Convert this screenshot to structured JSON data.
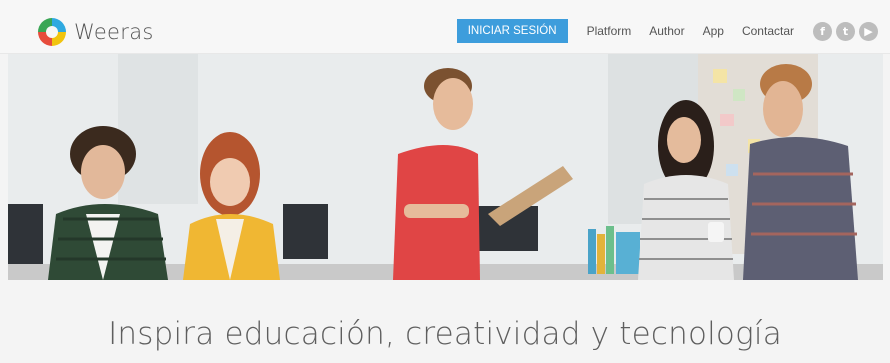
{
  "header": {
    "brand": "Weeras",
    "login_label": "INICIAR SESIÓN",
    "nav": [
      "Platform",
      "Author",
      "App",
      "Contactar"
    ],
    "social_icons": [
      "facebook-icon",
      "twitter-icon",
      "youtube-icon"
    ],
    "accent_color": "#3d9ddc"
  },
  "hero": {
    "tagline": "Inspira educación, creatividad y tecnología"
  }
}
